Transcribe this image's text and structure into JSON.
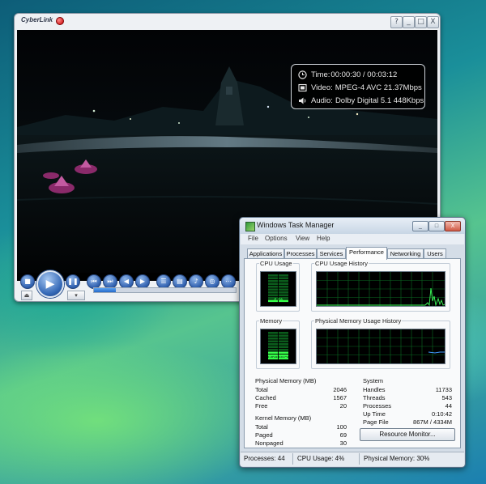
{
  "player": {
    "brand": "CyberLink",
    "window_buttons": [
      "?",
      "_",
      "□",
      "X"
    ],
    "osd": {
      "time_label": "Time:",
      "time_value": "00:00:30 / 00:03:12",
      "video_label": "Video:",
      "video_value": "MPEG-4 AVC  21.37Mbps",
      "audio_label": "Audio:",
      "audio_value": "Dolby Digital 5.1  448Kbps"
    },
    "seek_progress": 0.156,
    "icons": [
      "stop-icon",
      "play-icon",
      "pause-icon",
      "previous-icon",
      "next-icon",
      "rewind-icon",
      "fast-forward-icon",
      "menu-icon",
      "subtitle-icon",
      "audio-icon",
      "angle-icon",
      "more-icon",
      "eject-icon",
      "settings-icon"
    ]
  },
  "taskmanager": {
    "title": "Windows Task Manager",
    "window_buttons": [
      "_",
      "□",
      "X"
    ],
    "menu": [
      "File",
      "Options",
      "View",
      "Help"
    ],
    "tabs": [
      "Applications",
      "Processes",
      "Services",
      "Performance",
      "Networking",
      "Users"
    ],
    "active_tab": "Performance",
    "cpu_usage_label": "CPU Usage",
    "cpu_usage_value": "4 %",
    "cpu_history_label": "CPU Usage History",
    "memory_label": "Memory",
    "memory_value": "630 MB",
    "memory_history_label": "Physical Memory Usage History",
    "physical_memory": {
      "title": "Physical Memory (MB)",
      "rows": [
        {
          "label": "Total",
          "value": "2046"
        },
        {
          "label": "Cached",
          "value": "1567"
        },
        {
          "label": "Free",
          "value": "20"
        }
      ]
    },
    "kernel_memory": {
      "title": "Kernel Memory (MB)",
      "rows": [
        {
          "label": "Total",
          "value": "100"
        },
        {
          "label": "Paged",
          "value": "69"
        },
        {
          "label": "Nonpaged",
          "value": "30"
        }
      ]
    },
    "system": {
      "title": "System",
      "rows": [
        {
          "label": "Handles",
          "value": "11733"
        },
        {
          "label": "Threads",
          "value": "543"
        },
        {
          "label": "Processes",
          "value": "44"
        },
        {
          "label": "Up Time",
          "value": "0:10:42"
        },
        {
          "label": "Page File",
          "value": "867M / 4334M"
        }
      ]
    },
    "resource_monitor_button": "Resource Monitor...",
    "status": {
      "processes": "Processes: 44",
      "cpu": "CPU Usage: 4%",
      "memory": "Physical Memory: 30%"
    },
    "cpu_level": 0.04,
    "memory_level": 0.3
  }
}
